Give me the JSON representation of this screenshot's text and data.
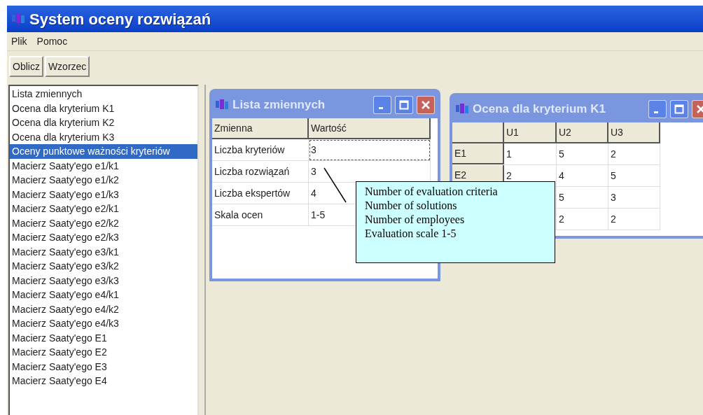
{
  "window": {
    "title": "System oceny rozwiązań"
  },
  "menu": [
    "Plik",
    "Pomoc"
  ],
  "toolbar": [
    "Oblicz",
    "Wzorzec"
  ],
  "sidebar": {
    "items": [
      {
        "label": "Lista zmiennych",
        "selected": false
      },
      {
        "label": "Ocena dla kryterium K1",
        "selected": false
      },
      {
        "label": "Ocena dla kryterium K2",
        "selected": false
      },
      {
        "label": "Ocena dla kryterium K3",
        "selected": false
      },
      {
        "label": "Oceny punktowe ważności kryteriów",
        "selected": true
      },
      {
        "label": "Macierz Saaty'ego e1/k1",
        "selected": false
      },
      {
        "label": "Macierz Saaty'ego e1/k2",
        "selected": false
      },
      {
        "label": "Macierz Saaty'ego e1/k3",
        "selected": false
      },
      {
        "label": "Macierz Saaty'ego e2/k1",
        "selected": false
      },
      {
        "label": "Macierz Saaty'ego e2/k2",
        "selected": false
      },
      {
        "label": "Macierz Saaty'ego e2/k3",
        "selected": false
      },
      {
        "label": "Macierz Saaty'ego e3/k1",
        "selected": false
      },
      {
        "label": "Macierz Saaty'ego e3/k2",
        "selected": false
      },
      {
        "label": "Macierz Saaty'ego e3/k3",
        "selected": false
      },
      {
        "label": "Macierz Saaty'ego e4/k1",
        "selected": false
      },
      {
        "label": "Macierz Saaty'ego e4/k2",
        "selected": false
      },
      {
        "label": "Macierz Saaty'ego e4/k3",
        "selected": false
      },
      {
        "label": "Macierz Saaty'ego E1",
        "selected": false
      },
      {
        "label": "Macierz Saaty'ego E2",
        "selected": false
      },
      {
        "label": "Macierz Saaty'ego E3",
        "selected": false
      },
      {
        "label": "Macierz Saaty'ego E4",
        "selected": false
      }
    ]
  },
  "variables_window": {
    "title": "Lista zmiennych",
    "columns": [
      "Zmienna",
      "Wartość"
    ],
    "rows": [
      {
        "name": "Liczba kryteriów",
        "value": "3",
        "focused": true
      },
      {
        "name": "Liczba rozwiązań",
        "value": "3",
        "focused": false
      },
      {
        "name": "Liczba ekspertów",
        "value": "4",
        "focused": false
      },
      {
        "name": "Skala ocen",
        "value": "1-5",
        "focused": false
      }
    ]
  },
  "criterion_window": {
    "title": "Ocena dla kryterium K1",
    "columns": [
      "U1",
      "U2",
      "U3"
    ],
    "rows": [
      {
        "header": "E1",
        "cells": [
          "1",
          "5",
          "2"
        ]
      },
      {
        "header": "E2",
        "cells": [
          "2",
          "4",
          "5"
        ]
      },
      {
        "header": null,
        "cells": [
          null,
          "5",
          "3"
        ]
      },
      {
        "header": null,
        "cells": [
          null,
          "2",
          "2"
        ]
      }
    ]
  },
  "callout": {
    "lines": [
      "Number of evaluation criteria",
      "Number of solutions",
      "Number of employees",
      "Evaluation scale 1-5"
    ]
  }
}
